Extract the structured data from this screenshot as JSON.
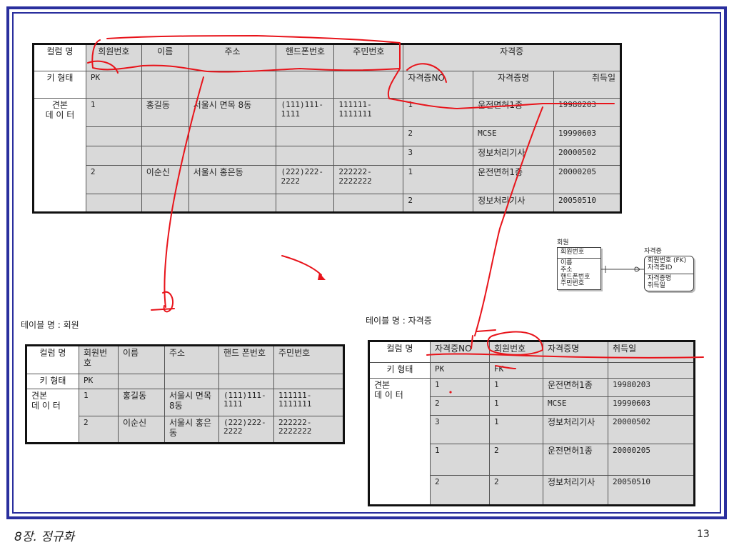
{
  "slide": {
    "chapter": "8장. 정규화",
    "page_number": "13"
  },
  "top_table": {
    "headers": {
      "col_name": "컬럼 명",
      "key_type": "키 형태",
      "sample": "견본\n데 이 터"
    },
    "columns": [
      "회원번호",
      "이름",
      "주소",
      "핸드폰번호",
      "주민번호",
      "자격증"
    ],
    "cert_sub": [
      "자격증NO",
      "자격증명",
      "취득일"
    ],
    "key_pk": "PK",
    "rows": [
      {
        "id": "1",
        "name": "홍길동",
        "addr": "서울시 면목 8동",
        "phone": "(111)111-1111",
        "jumin": "111111-1111111",
        "certs": [
          [
            "1",
            "운전면허1종",
            "19980203"
          ],
          [
            "2",
            "MCSE",
            "19990603"
          ],
          [
            "3",
            "정보처리기사",
            "20000502"
          ]
        ]
      },
      {
        "id": "2",
        "name": "이순신",
        "addr": "서울시 홍은동",
        "phone": "(222)222-2222",
        "jumin": "222222-2222222",
        "certs": [
          [
            "1",
            "운전면허1종",
            "20000205"
          ],
          [
            "2",
            "정보처리기사",
            "20050510"
          ]
        ]
      }
    ]
  },
  "member_table": {
    "caption": "테이블 명 : 회원",
    "headers": {
      "col_name": "컬럼 명",
      "key_type": "키 형태",
      "sample": "견본\n데 이 터"
    },
    "columns": [
      "회원번호",
      "이름",
      "주소",
      "핸드 폰번호",
      "주민번호"
    ],
    "key_pk": "PK",
    "rows": [
      [
        "1",
        "홍길동",
        "서울시 면목 8동",
        "(111)111-1111",
        "111111-1111111"
      ],
      [
        "2",
        "이순신",
        "서울시 홍은동",
        "(222)222-2222",
        "222222-2222222"
      ]
    ]
  },
  "cert_table": {
    "caption": "테이블 명 : 자격증",
    "headers": {
      "col_name": "컬럼 명",
      "key_type": "키 형태",
      "sample": "견본\n데 이 터"
    },
    "columns": [
      "자격증NO",
      "회원번호",
      "자격증명",
      "취득일"
    ],
    "keys": [
      "PK",
      "FK",
      "",
      ""
    ],
    "rows": [
      [
        "1",
        "1",
        "운전면허1종",
        "19980203"
      ],
      [
        "2",
        "1",
        "MCSE",
        "19990603"
      ],
      [
        "3",
        "1",
        "정보처리기사",
        "20000502"
      ],
      [
        "1",
        "2",
        "운전면허1종",
        "20000205"
      ],
      [
        "2",
        "2",
        "정보처리기사",
        "20050510"
      ]
    ]
  },
  "erd": {
    "member": {
      "title": "회원",
      "pk": "회원번호",
      "attrs": [
        "이름",
        "주소",
        "핸드폰번호",
        "주민번호"
      ]
    },
    "cert": {
      "title": "자격증",
      "pk": [
        "회원번호 (FK)",
        "자격증ID"
      ],
      "attrs": [
        "자격증명",
        "취득일"
      ]
    }
  },
  "colors": {
    "frame": "#2a2f9e",
    "cell_fill": "#d9d9d9",
    "annotation": "#e8141b"
  }
}
